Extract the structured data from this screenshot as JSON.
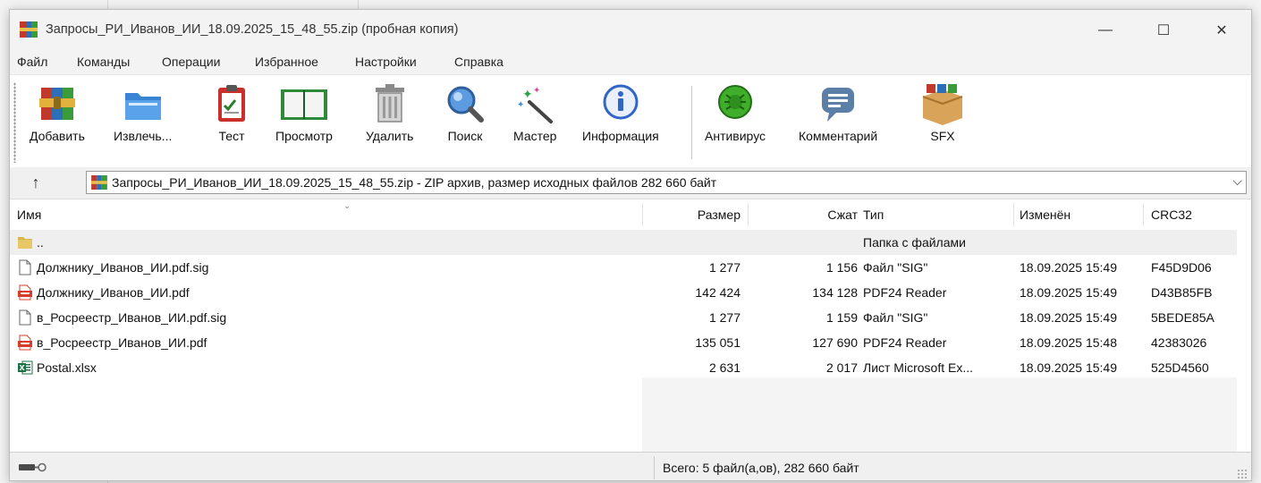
{
  "window": {
    "title": "Запросы_РИ_Иванов_ИИ_18.09.2025_15_48_55.zip (пробная копия)",
    "controls": {
      "minimize": "—",
      "maximize": "☐",
      "close": "✕"
    }
  },
  "menu": [
    "Файл",
    "Команды",
    "Операции",
    "Избранное",
    "Настройки",
    "Справка"
  ],
  "toolbar": [
    {
      "label": "Добавить",
      "icon": "add-archive-icon"
    },
    {
      "label": "Извлечь...",
      "icon": "extract-folder-icon"
    },
    {
      "label": "Тест",
      "icon": "test-clipboard-icon"
    },
    {
      "label": "Просмотр",
      "icon": "view-book-icon"
    },
    {
      "label": "Удалить",
      "icon": "trash-icon"
    },
    {
      "label": "Поиск",
      "icon": "magnifier-icon"
    },
    {
      "label": "Мастер",
      "icon": "wizard-wand-icon"
    },
    {
      "label": "Информация",
      "icon": "info-icon"
    },
    {
      "label": "Антивирус",
      "icon": "antivirus-bug-icon"
    },
    {
      "label": "Комментарий",
      "icon": "comment-icon"
    },
    {
      "label": "SFX",
      "icon": "sfx-box-icon"
    }
  ],
  "address": {
    "up": "↑",
    "text": "Запросы_РИ_Иванов_ИИ_18.09.2025_15_48_55.zip - ZIP архив, размер исходных файлов 282 660 байт",
    "chevron": "⌵"
  },
  "columns": {
    "name": "Имя",
    "size": "Размер",
    "packed": "Сжат",
    "type": "Тип",
    "modified": "Изменён",
    "crc": "CRC32",
    "sort_indicator": "⌄"
  },
  "files": [
    {
      "name": "..",
      "size": "",
      "packed": "",
      "type": "Папка с файлами",
      "modified": "",
      "crc": "",
      "icon": "folder-icon"
    },
    {
      "name": "Должнику_Иванов_ИИ.pdf.sig",
      "size": "1 277",
      "packed": "1 156",
      "type": "Файл \"SIG\"",
      "modified": "18.09.2025 15:49",
      "crc": "F45D9D06",
      "icon": "blank-file-icon"
    },
    {
      "name": "Должнику_Иванов_ИИ.pdf",
      "size": "142 424",
      "packed": "134 128",
      "type": "PDF24 Reader",
      "modified": "18.09.2025 15:49",
      "crc": "D43B85FB",
      "icon": "pdf-file-icon"
    },
    {
      "name": "в_Росреестр_Иванов_ИИ.pdf.sig",
      "size": "1 277",
      "packed": "1 159",
      "type": "Файл \"SIG\"",
      "modified": "18.09.2025 15:49",
      "crc": "5BEDE85A",
      "icon": "blank-file-icon"
    },
    {
      "name": "в_Росреестр_Иванов_ИИ.pdf",
      "size": "135 051",
      "packed": "127 690",
      "type": "PDF24 Reader",
      "modified": "18.09.2025 15:48",
      "crc": "42383026",
      "icon": "pdf-file-icon"
    },
    {
      "name": "Postal.xlsx",
      "size": "2 631",
      "packed": "2 017",
      "type": "Лист Microsoft Ex...",
      "modified": "18.09.2025 15:49",
      "crc": "525D4560",
      "icon": "excel-file-icon"
    }
  ],
  "status": {
    "text": "Всего: 5 файл(а,ов), 282 660 байт",
    "icons": [
      "drive-icon",
      "key-icon"
    ]
  },
  "colors": {
    "pdf_red": "#d83b2b",
    "excel_green": "#1e7145",
    "folder_yellow": "#d9b64b",
    "info_blue": "#2f66c8",
    "antivirus_green": "#3fae2a"
  }
}
